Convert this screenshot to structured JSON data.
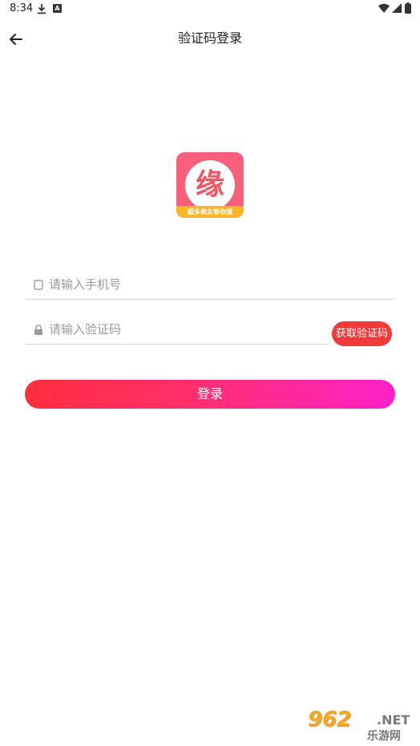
{
  "status_bar": {
    "time": "8:34",
    "notification_letter": "A",
    "icons": [
      "download-icon",
      "a-icon",
      "wifi-icon",
      "signal-icon",
      "battery-icon"
    ]
  },
  "header": {
    "title": "验证码登录",
    "back_icon": "arrow-left-icon"
  },
  "logo": {
    "character": "缘",
    "ribbon_text": "超多美女等你撩",
    "colors": {
      "background": "#f7607a",
      "ribbon": "#fbb529",
      "character": "#ef5565"
    }
  },
  "form": {
    "phone": {
      "placeholder": "请输入手机号",
      "value": "",
      "icon": "phone-icon"
    },
    "code": {
      "placeholder": "请输入验证码",
      "value": "",
      "icon": "lock-icon"
    },
    "get_code_label": "获取验证码",
    "login_label": "登录"
  },
  "colors": {
    "get_code_button": "#f23a3a",
    "login_gradient_start": "#ff2e3d",
    "login_gradient_end": "#ff21c8"
  },
  "watermark": {
    "brand_number": "962",
    "brand_suffix": ".NET",
    "subtitle": "乐游网"
  }
}
